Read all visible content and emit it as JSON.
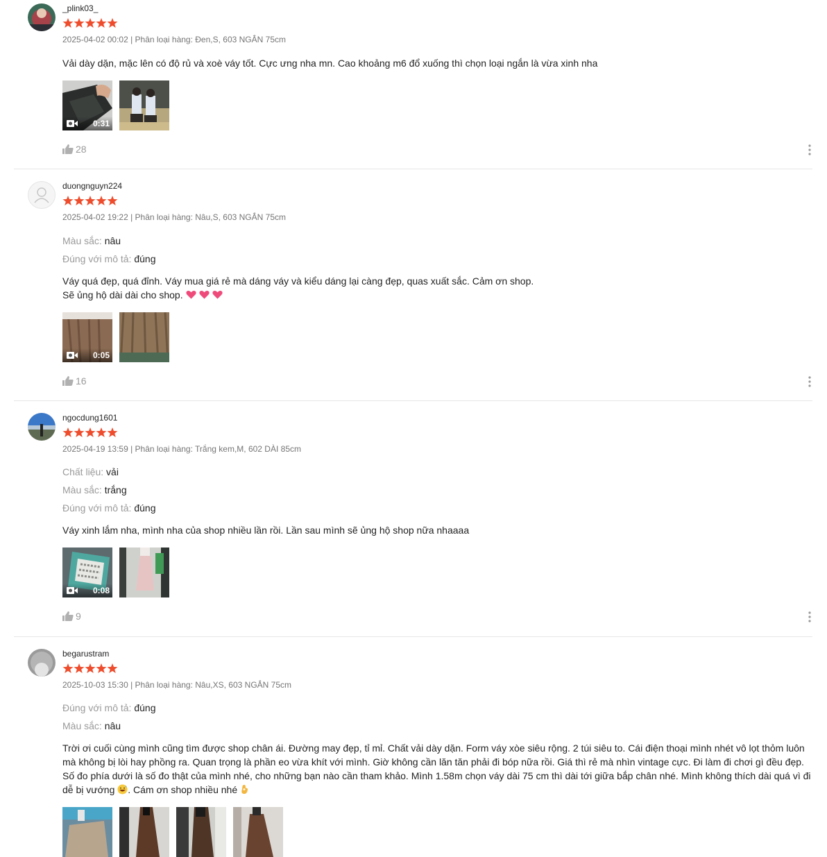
{
  "colors": {
    "star": "#ee4d2d",
    "meta_text": "#757575",
    "label_text": "#9a9a9a",
    "divider": "#e6e6e6",
    "heart": "#ee4b7b"
  },
  "reviews": [
    {
      "username": "_plink03_",
      "rating": 5,
      "meta": "2025-04-02 00:02 | Phân loại hàng: Đen,S, 603 NGẮN 75cm",
      "attributes": [],
      "body": [
        "Vải dày dặn, mặc lên có độ rủ và xoè váy tốt. Cực ưng nha mn. Cao khoảng m6 đổ xuống thì chọn loại ngắn là vừa xinh nha"
      ],
      "media": [
        {
          "type": "video",
          "duration": "0:31",
          "icon": "video-camera-icon"
        },
        {
          "type": "image"
        }
      ],
      "likes": "28"
    },
    {
      "username": "duongnguyn224",
      "rating": 5,
      "meta": "2025-04-02 19:22 | Phân loại hàng: Nâu,S, 603 NGẮN 75cm",
      "attributes": [
        {
          "label": "Màu sắc:",
          "value": "nâu"
        },
        {
          "label": "Đúng với mô tả:",
          "value": "đúng"
        }
      ],
      "body": [
        "Váy quá đẹp, quá đỉnh. Váy mua giá rẻ mà dáng váy và kiểu dáng lại càng đẹp, quas xuất sắc. Cảm ơn shop.",
        "Sẽ ủng hộ dài dài cho shop."
      ],
      "body_emoji": [
        "heart-icon",
        "heart-icon",
        "heart-icon"
      ],
      "media": [
        {
          "type": "video",
          "duration": "0:05",
          "icon": "video-camera-icon"
        },
        {
          "type": "image"
        }
      ],
      "likes": "16"
    },
    {
      "username": "ngocdung1601",
      "rating": 5,
      "meta": "2025-04-19 13:59 | Phân loại hàng: Trắng kem,M, 602 DÀI 85cm",
      "attributes": [
        {
          "label": "Chất liệu:",
          "value": "vải"
        },
        {
          "label": "Màu sắc:",
          "value": "trắng"
        },
        {
          "label": "Đúng với mô tả:",
          "value": "đúng"
        }
      ],
      "body": [
        "Váy xinh lắm nha, mình nha của shop nhiều lần rồi. Lần sau mình sẽ ủng hộ shop nữa nhaaaa"
      ],
      "media": [
        {
          "type": "video",
          "duration": "0:08",
          "icon": "video-camera-icon"
        },
        {
          "type": "image"
        }
      ],
      "likes": "9"
    },
    {
      "username": "begarustram",
      "rating": 5,
      "meta": "2025-10-03 15:30 | Phân loại hàng: Nâu,XS, 603 NGẮN 75cm",
      "attributes": [
        {
          "label": "Đúng với mô tả:",
          "value": "đúng"
        },
        {
          "label": "Màu sắc:",
          "value": "nâu"
        }
      ],
      "body": [
        "Trời ơi cuối cùng mình cũng tìm được shop chân ái. Đường may đẹp, tỉ mỉ. Chất vải dày dặn. Form váy xòe siêu rộng. 2 túi siêu to. Cái điện thoại mình nhét vô lọt thỏm luôn mà không bị lòi hay phồng ra. Quan trọng là phần eo vừa khít với mình. Giờ không cần lăn tăn phải đi bóp nữa rồi. Giá thì rẻ mà nhìn vintage cực. Đi làm đi chơi gì đều đẹp. Số đo phía dưới là số đo thật của mình nhé, cho những bạn nào cần tham khảo. Mình 1.58m chọn váy dài 75 cm thì dài tới giữa bắp chân nhé. Mình không thích dài quá vì đi dễ bị vướng"
      ],
      "body_tail": ". Cám ơn shop nhiều nhé",
      "body_emoji": [
        "grinning-sweat-face-icon",
        "ok-hand-icon"
      ],
      "media": [
        {
          "type": "image"
        },
        {
          "type": "image"
        },
        {
          "type": "image"
        },
        {
          "type": "image"
        }
      ],
      "likes": ""
    }
  ]
}
